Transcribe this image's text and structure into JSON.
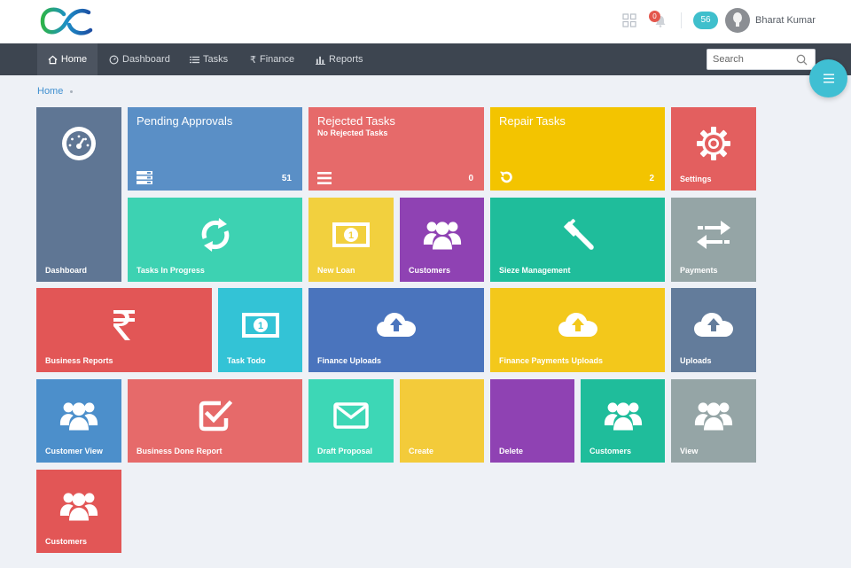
{
  "header": {
    "notifications_count": "0",
    "messages_count": "56",
    "user_name": "Bharat Kumar"
  },
  "nav": {
    "items": [
      {
        "label": "Home",
        "icon": "home-icon",
        "active": true
      },
      {
        "label": "Dashboard",
        "icon": "gauge-icon",
        "active": false
      },
      {
        "label": "Tasks",
        "icon": "list-icon",
        "active": false
      },
      {
        "label": "Finance",
        "icon": "rupee-icon",
        "active": false
      },
      {
        "label": "Reports",
        "icon": "bar-chart-icon",
        "active": false
      }
    ],
    "search_placeholder": "Search"
  },
  "breadcrumb": {
    "home": "Home"
  },
  "tiles": {
    "dashboard": {
      "label": "Dashboard",
      "color": "#5f7694",
      "icon": "speedometer-icon"
    },
    "pending_approvals": {
      "title": "Pending Approvals",
      "count": "51",
      "color": "#5a8fc6",
      "icon": "server-icon"
    },
    "rejected_tasks": {
      "title": "Rejected Tasks",
      "subtitle": "No Rejected Tasks",
      "count": "0",
      "color": "#e66a6a",
      "icon": "bars-icon"
    },
    "repair_tasks": {
      "title": "Repair Tasks",
      "count": "2",
      "color": "#f3c400",
      "icon": "undo-icon"
    },
    "settings": {
      "label": "Settings",
      "color": "#e35f5f",
      "icon": "gear-icon"
    },
    "tasks_in_progress": {
      "label": "Tasks In Progress",
      "color": "#3dd2b2",
      "icon": "refresh-icon"
    },
    "new_loan": {
      "label": "New Loan",
      "color": "#f2d03e",
      "icon": "money-icon"
    },
    "customers_1": {
      "label": "Customers",
      "color": "#8f42b3",
      "icon": "users-icon"
    },
    "sieze_management": {
      "label": "Sieze Management",
      "color": "#1fbd9b",
      "icon": "gavel-icon"
    },
    "payments": {
      "label": "Payments",
      "color": "#95a5a6",
      "icon": "exchange-icon"
    },
    "business_reports": {
      "label": "Business Reports",
      "color": "#e25656",
      "icon": "rupee-icon"
    },
    "task_todo": {
      "label": "Task Todo",
      "color": "#33c3d6",
      "icon": "money-icon"
    },
    "finance_uploads": {
      "label": "Finance Uploads",
      "color": "#4a74bd",
      "icon": "cloud-upload-icon"
    },
    "finance_payments_uploads": {
      "label": "Finance Payments Uploads",
      "color": "#f3c81b",
      "icon": "cloud-upload-icon"
    },
    "uploads": {
      "label": "Uploads",
      "color": "#637c9b",
      "icon": "cloud-upload-icon"
    },
    "customer_view": {
      "label": "Customer View",
      "color": "#4c8fcb",
      "icon": "users-icon"
    },
    "business_done_report": {
      "label": "Business Done Report",
      "color": "#e66a6a",
      "icon": "check-square-icon"
    },
    "draft_proposal": {
      "label": "Draft Proposal",
      "color": "#3dd7b6",
      "icon": "envelope-icon"
    },
    "create": {
      "label": "Create",
      "color": "#f3cb3a",
      "icon": ""
    },
    "delete": {
      "label": "Delete",
      "color": "#8f42b3",
      "icon": ""
    },
    "customers_2": {
      "label": "Customers",
      "color": "#1fbd9b",
      "icon": "users-icon"
    },
    "view": {
      "label": "View",
      "color": "#95a5a6",
      "icon": "users-icon"
    },
    "customers_3": {
      "label": "Customers",
      "color": "#e25656",
      "icon": "users-icon"
    }
  }
}
